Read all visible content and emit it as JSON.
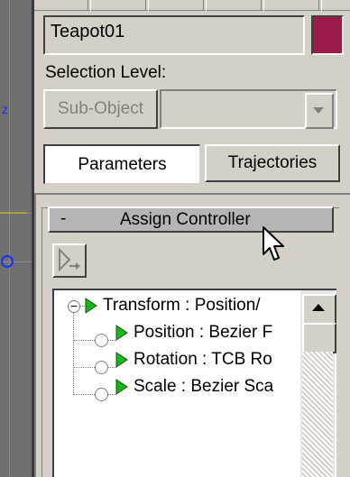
{
  "object": {
    "name": "Teapot01",
    "color": "#9b1c4a"
  },
  "selection_level": {
    "label": "Selection Level:",
    "subobject_button": "Sub-Object",
    "dropdown_value": ""
  },
  "tabs": [
    {
      "label": "Parameters",
      "active": true
    },
    {
      "label": "Trajectories",
      "active": false
    }
  ],
  "rollout": {
    "toggle": "-",
    "title": "Assign Controller"
  },
  "tree": [
    {
      "label": "Transform : Position/",
      "icon": "green-triangle-icon",
      "expander": "minus"
    },
    {
      "label": "Position : Bezier F",
      "icon": "green-triangle-icon"
    },
    {
      "label": "Rotation : TCB Ro",
      "icon": "green-triangle-icon"
    },
    {
      "label": "Scale : Bezier Sca",
      "icon": "green-triangle-icon"
    }
  ]
}
